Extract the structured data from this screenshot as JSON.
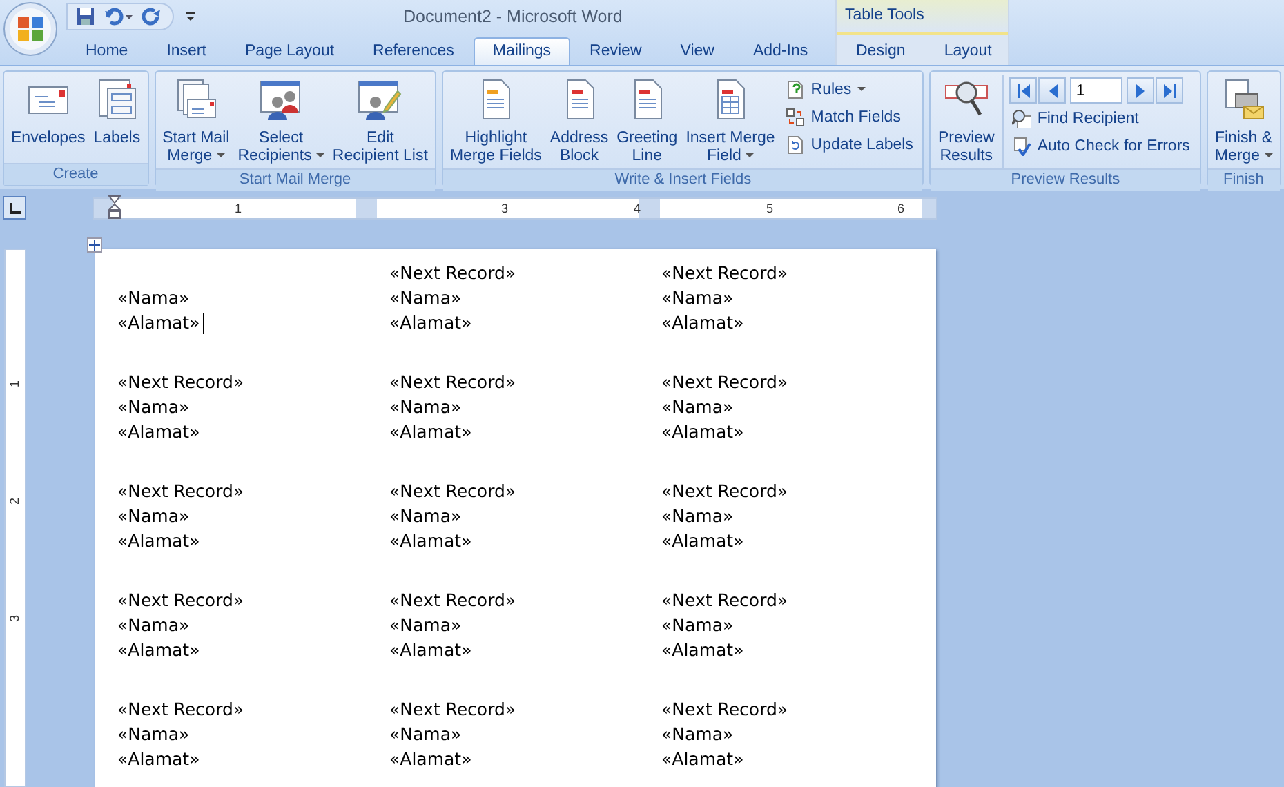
{
  "window": {
    "title": "Document2 - Microsoft Word"
  },
  "tabs": [
    {
      "label": "Home",
      "selected": false
    },
    {
      "label": "Insert",
      "selected": false
    },
    {
      "label": "Page Layout",
      "selected": false
    },
    {
      "label": "References",
      "selected": false
    },
    {
      "label": "Mailings",
      "selected": true
    },
    {
      "label": "Review",
      "selected": false
    },
    {
      "label": "View",
      "selected": false
    },
    {
      "label": "Add-Ins",
      "selected": false
    }
  ],
  "contextual_tabs": {
    "title": "Table Tools",
    "tabs": [
      {
        "label": "Design",
        "selected": false
      },
      {
        "label": "Layout",
        "selected": false
      }
    ]
  },
  "ribbon": {
    "groups": [
      {
        "label": "Create",
        "items": [
          {
            "kind": "large",
            "lines": [
              "Envelopes"
            ],
            "dropdown": false
          },
          {
            "kind": "large",
            "lines": [
              "Labels"
            ],
            "dropdown": false
          }
        ]
      },
      {
        "label": "Start Mail Merge",
        "items": [
          {
            "kind": "large",
            "lines": [
              "Start Mail",
              "Merge"
            ],
            "dropdown": true
          },
          {
            "kind": "large",
            "lines": [
              "Select",
              "Recipients"
            ],
            "dropdown": true
          },
          {
            "kind": "large",
            "lines": [
              "Edit",
              "Recipient List"
            ],
            "dropdown": false
          }
        ]
      },
      {
        "label": "Write & Insert Fields",
        "items": [
          {
            "kind": "large",
            "lines": [
              "Highlight",
              "Merge Fields"
            ],
            "dropdown": false
          },
          {
            "kind": "large",
            "lines": [
              "Address",
              "Block"
            ],
            "dropdown": false
          },
          {
            "kind": "large",
            "lines": [
              "Greeting",
              "Line"
            ],
            "dropdown": false
          },
          {
            "kind": "large",
            "lines": [
              "Insert Merge",
              "Field"
            ],
            "dropdown": true
          },
          {
            "kind": "stack",
            "items": [
              {
                "kind": "small",
                "label": "Rules",
                "dropdown": true
              },
              {
                "kind": "small",
                "label": "Match Fields",
                "dropdown": false
              },
              {
                "kind": "small",
                "label": "Update Labels",
                "dropdown": false
              }
            ]
          }
        ]
      },
      {
        "label": "Preview Results",
        "items": [
          {
            "kind": "large",
            "lines": [
              "Preview",
              "Results"
            ],
            "dropdown": false
          },
          {
            "kind": "stack",
            "items": [
              {
                "kind": "nav",
                "value": "1"
              },
              {
                "kind": "small",
                "label": "Find Recipient",
                "dropdown": false
              },
              {
                "kind": "small",
                "label": "Auto Check for Errors",
                "dropdown": false
              }
            ]
          }
        ]
      },
      {
        "label": "Finish",
        "items": [
          {
            "kind": "large",
            "lines": [
              "Finish &",
              "Merge"
            ],
            "dropdown": true
          }
        ]
      }
    ]
  },
  "ruler": {
    "numbers": [
      "1",
      "3",
      "4",
      "5",
      "6"
    ]
  },
  "vertical_ruler": {
    "numbers": [
      "1",
      "2",
      "3"
    ]
  },
  "document": {
    "rows": [
      {
        "cells": [
          {
            "lines": [
              "«Nama»",
              "«Alamat»"
            ],
            "cursor": true
          },
          {
            "lines": [
              "«Next Record»",
              "«Nama»",
              "«Alamat»"
            ],
            "cursor": false
          },
          {
            "lines": [
              "«Next Record»",
              "«Nama»",
              "«Alamat»"
            ],
            "cursor": false
          }
        ]
      },
      {
        "cells": [
          {
            "lines": [
              "«Next Record»",
              "«Nama»",
              "«Alamat»"
            ],
            "cursor": false
          },
          {
            "lines": [
              "«Next Record»",
              "«Nama»",
              "«Alamat»"
            ],
            "cursor": false
          },
          {
            "lines": [
              "«Next Record»",
              "«Nama»",
              "«Alamat»"
            ],
            "cursor": false
          }
        ]
      },
      {
        "cells": [
          {
            "lines": [
              "«Next Record»",
              "«Nama»",
              "«Alamat»"
            ],
            "cursor": false
          },
          {
            "lines": [
              "«Next Record»",
              "«Nama»",
              "«Alamat»"
            ],
            "cursor": false
          },
          {
            "lines": [
              "«Next Record»",
              "«Nama»",
              "«Alamat»"
            ],
            "cursor": false
          }
        ]
      },
      {
        "cells": [
          {
            "lines": [
              "«Next Record»",
              "«Nama»",
              "«Alamat»"
            ],
            "cursor": false
          },
          {
            "lines": [
              "«Next Record»",
              "«Nama»",
              "«Alamat»"
            ],
            "cursor": false
          },
          {
            "lines": [
              "«Next Record»",
              "«Nama»",
              "«Alamat»"
            ],
            "cursor": false
          }
        ]
      },
      {
        "cells": [
          {
            "lines": [
              "«Next Record»",
              "«Nama»",
              "«Alamat»"
            ],
            "cursor": false
          },
          {
            "lines": [
              "«Next Record»",
              "«Nama»",
              "«Alamat»"
            ],
            "cursor": false
          },
          {
            "lines": [
              "«Next Record»",
              "«Nama»",
              "«Alamat»"
            ],
            "cursor": false
          }
        ]
      }
    ]
  }
}
